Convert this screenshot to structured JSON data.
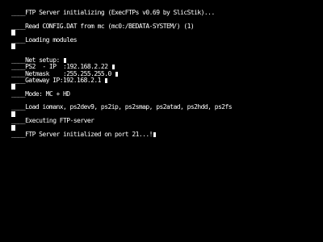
{
  "console": {
    "lines": {
      "l1": "____FTP Server initializing (ExecFTPs v0.69 by SlicStik)...",
      "l3": "____Read CONFIG.DAT from mc (mc0:/BEDATA-SYSTEM/) (1)",
      "l5": "____Loading modules",
      "l7": "____Net setup: ",
      "l8": "____PS2  - IP  :192.168.2.22 ",
      "l9": "____Netmask    :255.255.255.0 ",
      "l10": "____Gateway IP:192.168.2.1 ",
      "l12": "____Mode: MC + HD",
      "l14": "____Load iomanx, ps2dev9, ps2ip, ps2smap, ps2atad, ps2hdd, ps2fs",
      "l16": "____Executing FTP-server",
      "l18": "____FTP Server initialized on port 21...!"
    }
  }
}
